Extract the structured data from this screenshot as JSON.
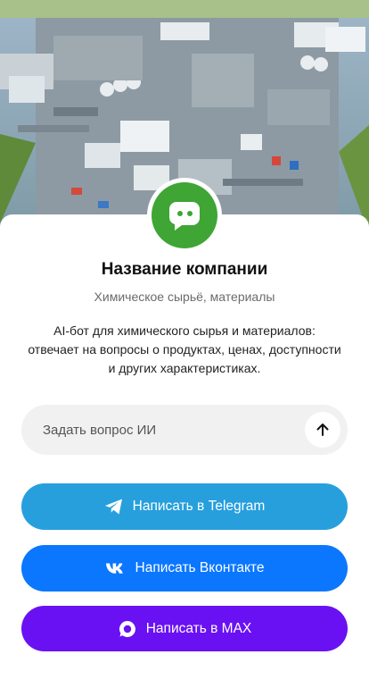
{
  "company": {
    "name": "Название компании",
    "category": "Химическое сырьё, материалы",
    "description": "AI-бот для химического сырья и материалов: отвечает на вопросы о продуктах, ценах, доступности и других характеристиках.",
    "logo_icon": "chat-bot-icon",
    "logo_color": "#3fa535",
    "hero_image": "chemical-plant-aerial-photo"
  },
  "ask": {
    "placeholder": "Задать вопрос ИИ",
    "send_icon": "arrow-up-icon"
  },
  "buttons": {
    "telegram": {
      "label": "Написать в Telegram",
      "icon": "telegram-icon",
      "color": "#279fdd"
    },
    "vk": {
      "label": "Написать Вконтакте",
      "icon": "vk-icon",
      "color": "#0b77ff"
    },
    "max": {
      "label": "Написать в MAX",
      "icon": "max-icon",
      "color": "#6a11f3"
    }
  }
}
